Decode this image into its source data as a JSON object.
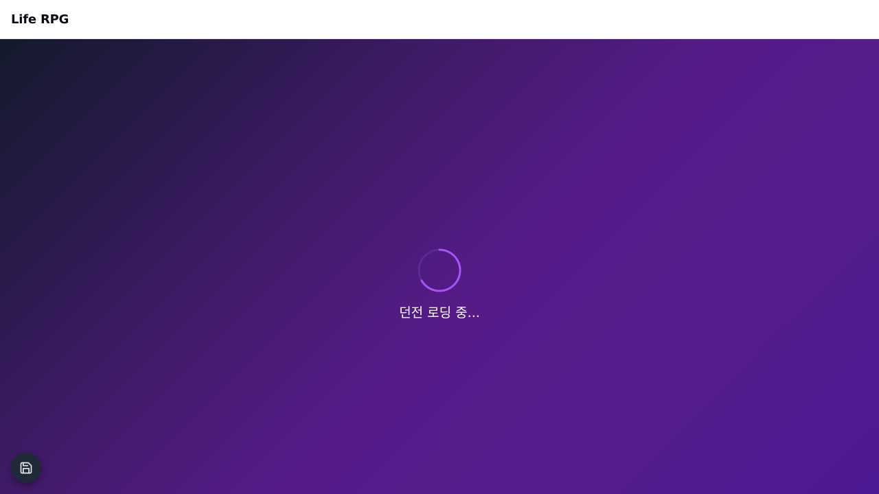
{
  "header": {
    "title": "Life RPG"
  },
  "loader": {
    "text": "던전 로딩 중...",
    "icon": "spinner-icon"
  },
  "fab": {
    "icon": "save-icon"
  },
  "colors": {
    "header_bg": "#ffffff",
    "title_text": "#0b0b14",
    "gradient_start": "#141a2c",
    "gradient_mid": "#561b89",
    "gradient_end": "#4c1a94",
    "spinner_accent": "#a855f7",
    "fab_bg": "#1f2937"
  }
}
